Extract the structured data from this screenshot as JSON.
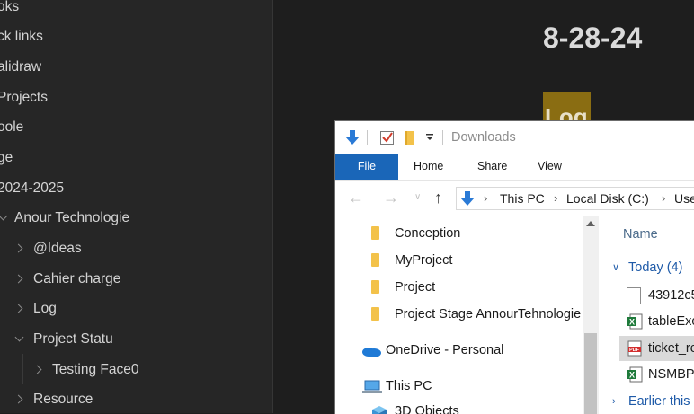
{
  "sidebar": {
    "items": [
      {
        "label": "oks"
      },
      {
        "label": "ck links"
      },
      {
        "label": "alidraw"
      },
      {
        "label": "Projects"
      },
      {
        "label": "oole"
      },
      {
        "label": "ge"
      },
      {
        "label": "2024-2025"
      },
      {
        "label": "Anour Technologie"
      },
      {
        "label": "@Ideas"
      },
      {
        "label": "Cahier charge"
      },
      {
        "label": "Log"
      },
      {
        "label": "Project Statu"
      },
      {
        "label": "Testing Face0"
      },
      {
        "label": "Resource"
      }
    ]
  },
  "editor": {
    "title": "8-28-24",
    "badge_text": "Log"
  },
  "explorer": {
    "window_title": "Downloads",
    "ribbon_tabs": [
      "File",
      "Home",
      "Share",
      "View"
    ],
    "breadcrumbs": [
      "This PC",
      "Local Disk (C:)",
      "Use"
    ],
    "nav_items": [
      {
        "label": "Conception",
        "icon": "folder-icon"
      },
      {
        "label": "MyProject",
        "icon": "folder-icon"
      },
      {
        "label": "Project",
        "icon": "folder-icon"
      },
      {
        "label": "Project Stage AnnourTehnologie",
        "icon": "folder-icon"
      },
      {
        "label": "OneDrive - Personal",
        "icon": "onedrive-icon"
      },
      {
        "label": "This PC",
        "icon": "computer-icon"
      },
      {
        "label": "3D Objects",
        "icon": "3d-objects-icon"
      }
    ],
    "column_header": "Name",
    "groups": [
      {
        "label": "Today (4)"
      },
      {
        "label": "Earlier this"
      }
    ],
    "files": [
      {
        "name": "43912c5",
        "icon": "file-icon"
      },
      {
        "name": "tableExc",
        "icon": "excel-icon"
      },
      {
        "name": "ticket_re",
        "icon": "pdf-icon",
        "selected": true
      },
      {
        "name": "NSMBPF",
        "icon": "excel-icon"
      }
    ],
    "colors": {
      "accent": "#1a66b8",
      "folder": "#f3c24a",
      "selection": "#cce8ff"
    }
  }
}
